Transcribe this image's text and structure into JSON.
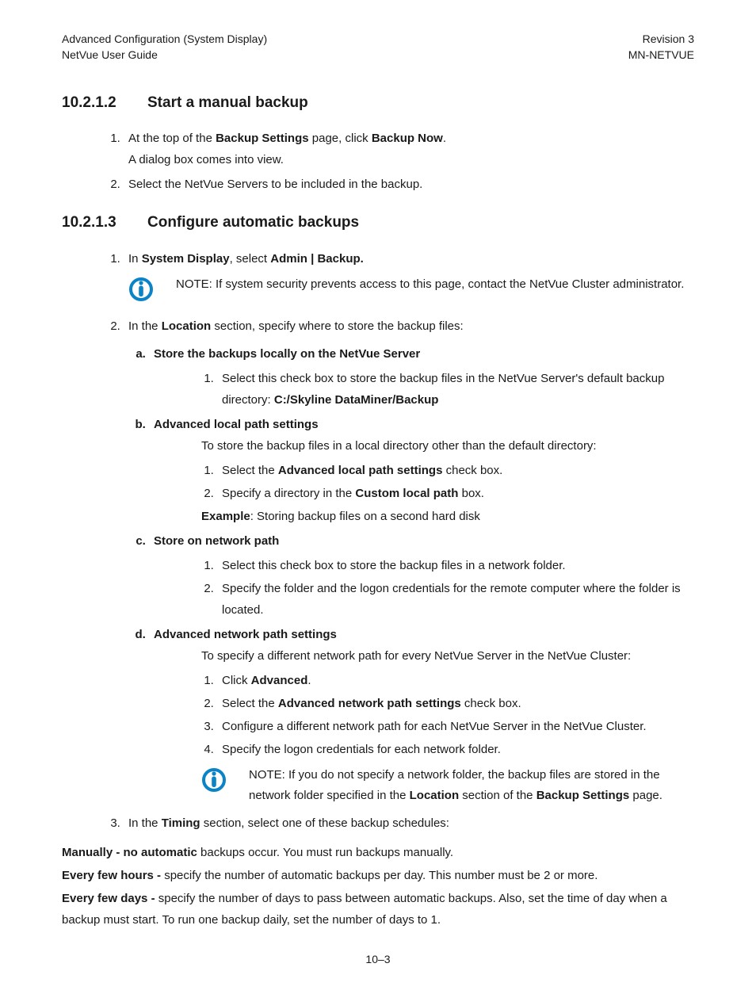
{
  "header": {
    "left1": "Advanced Configuration (System Display)",
    "left2": "NetVue User Guide",
    "right1": "Revision 3",
    "right2": "MN-NETVUE"
  },
  "sec1": {
    "num": "10.2.1.2",
    "title": "Start a manual backup",
    "li1a": "At the top of the ",
    "li1b": "Backup Settings",
    "li1c": " page, click ",
    "li1d": "Backup Now",
    "li1e": ".",
    "li1f": "A dialog box comes into view.",
    "li2": "Select the NetVue Servers to be included in the backup."
  },
  "sec2": {
    "num": "10.2.1.3",
    "title": "Configure automatic backups",
    "s1a": "In ",
    "s1b": "System Display",
    "s1c": ", select ",
    "s1d": "Admin | Backup.",
    "note1a": "NOTE:  If system security prevents access to this page, contact the NetVue Cluster administrator.",
    "s2a": "In the ",
    "s2b": "Location",
    "s2c": " section, specify where to store the backup files:",
    "a_title": "Store the backups locally on the NetVue Server",
    "a1a": "Select this check box to store the backup files in the NetVue Server's default backup directory:  ",
    "a1b": "C:/Skyline DataMiner/Backup",
    "b_title": "Advanced local path settings",
    "b_intro": "To store the backup files in a local directory other than the default directory:",
    "b1a": "Select the ",
    "b1b": "Advanced local path settings",
    "b1c": " check box.",
    "b2a": "Specify a directory in the ",
    "b2b": "Custom local path",
    "b2c": " box.",
    "b_ex_a": "Example",
    "b_ex_b": ": Storing backup files on a second hard disk",
    "c_title": "Store on network path",
    "c1": "Select this check box to store the backup files in a network folder.",
    "c2": "Specify the folder and the logon credentials for the remote computer where the folder is located.",
    "d_title": "Advanced network path settings",
    "d_intro": "To specify a different network path for every NetVue Server in the NetVue Cluster:",
    "d1a": "Click ",
    "d1b": "Advanced",
    "d1c": ".",
    "d2a": "Select the ",
    "d2b": "Advanced network path settings",
    "d2c": " check box.",
    "d3": "Configure a different network path for each NetVue Server in the NetVue Cluster.",
    "d4": "Specify the logon credentials for each network folder.",
    "note2a": "NOTE:  If you do not specify a network folder, the backup files are stored in the network folder specified in the ",
    "note2b": "Location",
    "note2c": " section of the ",
    "note2d": "Backup Settings",
    "note2e": " page.",
    "s3a": "In the ",
    "s3b": "Timing",
    "s3c": " section, select one of these backup schedules:",
    "m1a": "Manually - no automatic",
    "m1b": " backups occur. You must run backups manually.",
    "m2a": "Every few hours -",
    "m2b": " specify the number of automatic backups per day. This number must be 2 or more.",
    "m3a": "Every few days -",
    "m3b": " specify the number of days to pass between automatic backups. Also, set the time of day when a backup must start. To run one backup daily, set the number of days to 1."
  },
  "footer": "10–3"
}
